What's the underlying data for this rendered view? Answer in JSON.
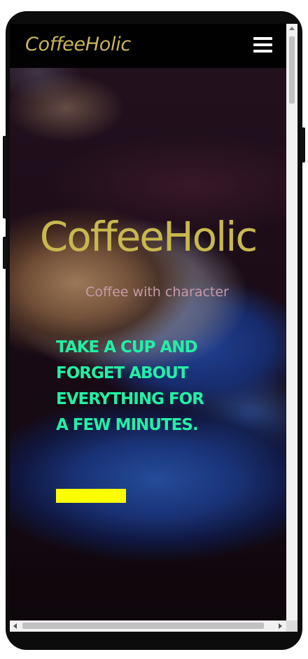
{
  "navbar": {
    "brand": "CoffeeHolic",
    "menu_icon": "hamburger-menu-icon"
  },
  "hero": {
    "title": "CoffeeHolic",
    "subtitle": "Coffee with character",
    "tagline": "TAKE A CUP AND FORGET ABOUT EVERYTHING FOR A FEW MINUTES.",
    "button_label": ""
  },
  "colors": {
    "brand_gold": "#c9b45a",
    "tagline_green": "#22f0a5",
    "subtitle_pink": "#c79aa8",
    "button_yellow": "#ffff00",
    "navbar_bg": "#000000"
  }
}
